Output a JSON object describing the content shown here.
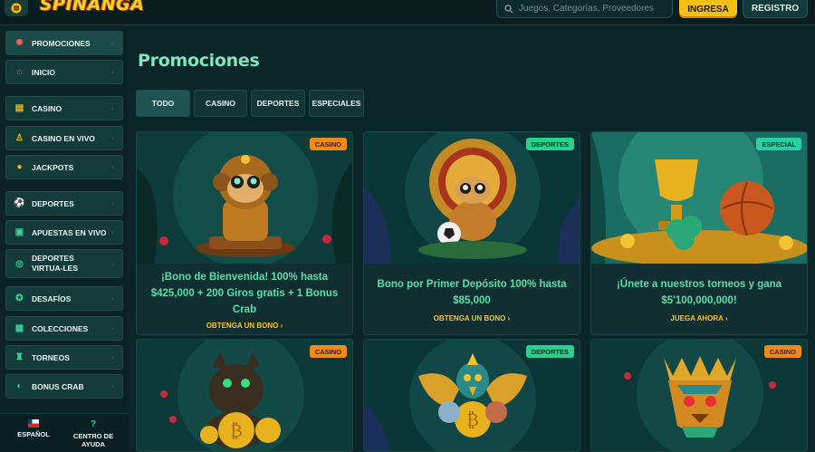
{
  "header": {
    "logo_text": "SPINANGA",
    "search_placeholder": "Juegos, Categorías, Proveedores",
    "login_label": "INGRESA",
    "register_label": "REGISTRO"
  },
  "sidebar": {
    "items": [
      {
        "label": "PROMOCIONES",
        "icon": "gift-icon"
      },
      {
        "label": "INICIO",
        "icon": "home-icon"
      },
      {
        "label": "CASINO",
        "icon": "slot-machine-icon"
      },
      {
        "label": "CASINO EN VIVO",
        "icon": "dealer-icon"
      },
      {
        "label": "JACKPOTS",
        "icon": "coins-icon"
      },
      {
        "label": "DEPORTES",
        "icon": "soccer-ball-icon"
      },
      {
        "label": "APUESTAS EN VIVO",
        "icon": "live-tv-icon"
      },
      {
        "label": "DEPORTES VIRTUA-LES",
        "icon": "virtual-sports-icon"
      },
      {
        "label": "DESAFÍOS",
        "icon": "challenge-icon"
      },
      {
        "label": "COLECCIONES",
        "icon": "collection-icon"
      },
      {
        "label": "TORNEOS",
        "icon": "trophy-icon"
      },
      {
        "label": "BONUS CRAB",
        "icon": "crab-icon"
      }
    ],
    "bottom": {
      "language_label": "ESPAÑOL",
      "help_label": "CENTRO DE AYUDA"
    }
  },
  "main": {
    "title": "Promociones",
    "tabs": [
      "TODO",
      "CASINO",
      "DEPORTES",
      "ESPECIALES"
    ],
    "cards": [
      {
        "badge": "CASINO",
        "badge_type": "casino",
        "title": "¡Bono de Bienvenida! 100% hasta $425,000 + 200 Giros gratis + 1 Bonus Crab",
        "cta": "OBTENGA UN BONO"
      },
      {
        "badge": "DEPORTES",
        "badge_type": "deportes",
        "title": "Bono por Primer Depósito 100% hasta $85,000",
        "cta": "OBTENGA UN BONO"
      },
      {
        "badge": "ESPECIAL",
        "badge_type": "especial",
        "title": "¡Únete a nuestros torneos y gana $5'100,000,000!",
        "cta": "JUEGA AHORA"
      },
      {
        "badge": "CASINO",
        "badge_type": "casino"
      },
      {
        "badge": "DEPORTES",
        "badge_type": "deportes"
      },
      {
        "badge": "CASINO",
        "badge_type": "casino"
      }
    ]
  },
  "colors": {
    "accent_green": "#56e0a8",
    "accent_yellow": "#f6c012",
    "background": "#0b2628"
  }
}
